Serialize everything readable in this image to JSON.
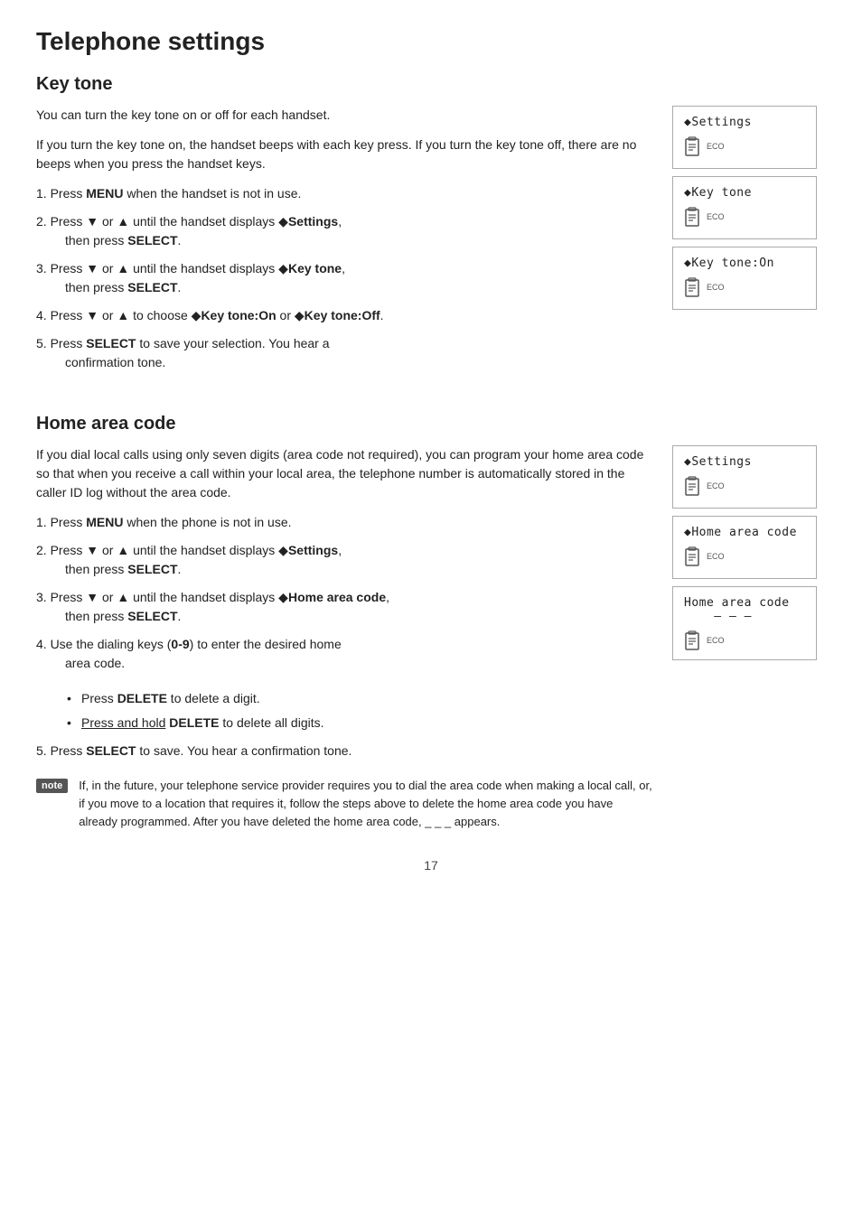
{
  "page": {
    "title": "Telephone settings",
    "number": "17"
  },
  "key_tone_section": {
    "heading": "Key tone",
    "intro1": "You can turn the key tone on or off for each handset.",
    "intro2": "If you turn the key tone on, the handset beeps with each key press. If you turn the key tone off, there are no beeps when you press the handset keys.",
    "steps": [
      {
        "num": "1.",
        "text": "Press ",
        "bold": "MENU",
        "text2": " when the handset is not in use.",
        "indent": false
      },
      {
        "num": "2.",
        "text": "Press ▼ or ▲ until the handset displays ◆",
        "bold": "Settings",
        "text2": ",",
        "text3": "then press ",
        "bold2": "SELECT",
        "text4": ".",
        "indent": true
      },
      {
        "num": "3.",
        "text": "Press ▼ or ▲ until the handset displays ◆",
        "bold": "Key tone",
        "text2": ",",
        "text3": "then press ",
        "bold2": "SELECT",
        "text4": ".",
        "indent": true
      },
      {
        "num": "4.",
        "text": "Press ▼ or ▲ to choose ◆",
        "bold": "Key tone:On",
        "text2": " or ◆",
        "bold2": "Key tone:Off",
        "text3": ".",
        "indent": false
      },
      {
        "num": "5.",
        "text": "Press ",
        "bold": "SELECT",
        "text2": " to save your selection. You hear a",
        "text3": "confirmation tone.",
        "indent": true
      }
    ],
    "screens": [
      {
        "display": "◆Settings",
        "eco": true
      },
      {
        "display": "◆Key tone",
        "eco": true
      },
      {
        "display": "◆Key tone:On",
        "eco": true
      }
    ]
  },
  "home_area_code_section": {
    "heading": "Home area code",
    "intro": "If you dial local calls using only seven digits (area code not required), you can program your home area code so that when you receive a call within your local area, the telephone number is automatically stored in the caller ID log without the area code.",
    "steps": [
      {
        "num": "1.",
        "text": "Press ",
        "bold": "MENU",
        "text2": " when the phone is not in use.",
        "indent": false
      },
      {
        "num": "2.",
        "text": "Press ▼ or ▲ until the handset displays ◆",
        "bold": "Settings",
        "text2": ",",
        "text3": "then press ",
        "bold2": "SELECT",
        "text4": ".",
        "indent": true
      },
      {
        "num": "3.",
        "text": "Press ▼ or ▲ until the handset displays ◆",
        "bold": "Home area code",
        "text2": ",",
        "text3": "then press ",
        "bold2": "SELECT",
        "text4": ".",
        "indent": true
      },
      {
        "num": "4.",
        "text": "Use the dialing keys (",
        "bold": "0-9",
        "text2": ") to enter the desired home",
        "text3": "area code.",
        "indent": true
      }
    ],
    "bullets": [
      {
        "text": "Press ",
        "bold": "DELETE",
        "text2": " to delete a digit.",
        "underline": false
      },
      {
        "text": "Press and hold ",
        "bold": "DELETE",
        "text2": " to delete all digits.",
        "underline": true
      }
    ],
    "step5": {
      "num": "5.",
      "text": "Press ",
      "bold": "SELECT",
      "text2": " to save. You hear a confirmation tone."
    },
    "screens": [
      {
        "display": "◆Settings",
        "eco": true
      },
      {
        "display": "◆Home area code",
        "eco": true
      },
      {
        "display": "Home area code\n    — — —",
        "eco": true
      }
    ],
    "note": {
      "label": "note",
      "text": "If, in the future, your telephone service provider requires you to dial the area code when making a local call, or, if you move to a location that requires it, follow the steps above to delete the home area code you have already programmed. After you have deleted the home area code, _ _ _ appears."
    }
  }
}
